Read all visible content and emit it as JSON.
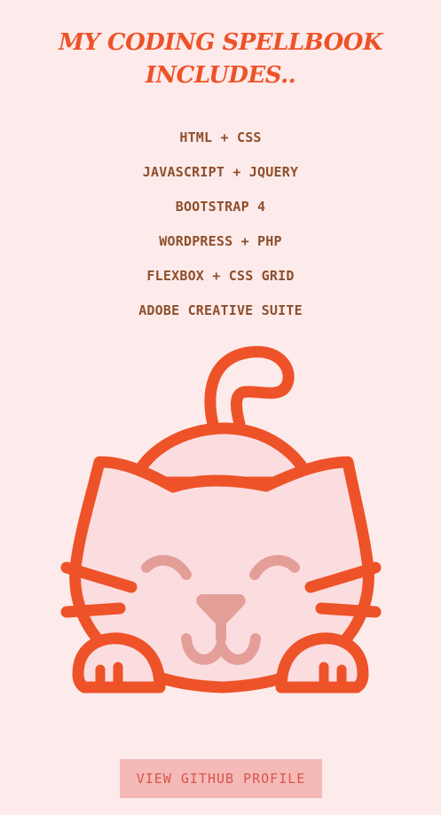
{
  "heading": {
    "line1": "MY CODING SPELLBOOK",
    "line2": "INCLUDES.."
  },
  "skills": [
    "HTML + CSS",
    "JAVASCRIPT + JQUERY",
    "BOOTSTRAP 4",
    "WORDPRESS + PHP",
    "FLEXBOX + CSS GRID",
    "ADOBE CREATIVE SUITE"
  ],
  "button": {
    "label": "VIEW GITHUB PROFILE"
  },
  "colors": {
    "background": "#fdebeb",
    "heading": "#ee5228",
    "skill_text": "#8e4f2c",
    "cat_outline": "#ee5228",
    "cat_fill": "#fbdde0",
    "cat_face": "#e49e98",
    "button_bg": "#f5b9b8",
    "button_text": "#d8554a"
  },
  "illustration": {
    "icon": "cat-icon"
  }
}
